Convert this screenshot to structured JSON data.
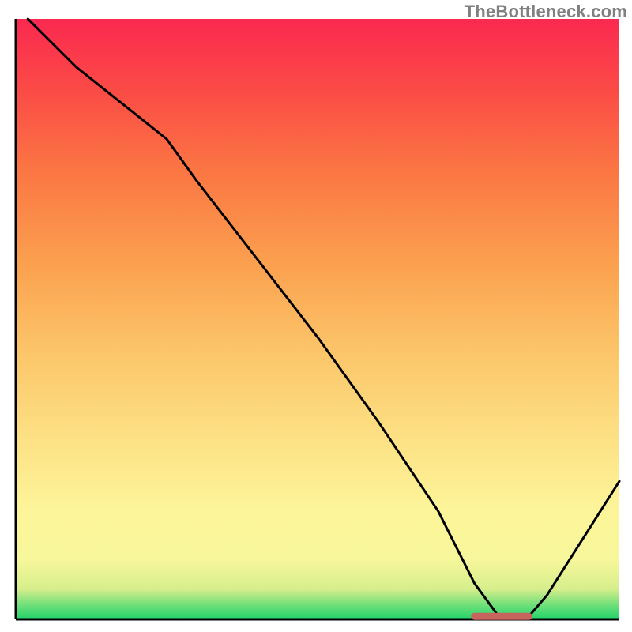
{
  "watermark": "TheBottleneck.com",
  "chart_data": {
    "type": "line",
    "title": "",
    "xlabel": "",
    "ylabel": "",
    "xlim": [
      0,
      100
    ],
    "ylim": [
      0,
      100
    ],
    "gradient": {
      "stops": [
        {
          "offset": 0.0,
          "color": "#22d36b"
        },
        {
          "offset": 0.025,
          "color": "#72e07a"
        },
        {
          "offset": 0.05,
          "color": "#d6ee8c"
        },
        {
          "offset": 0.1,
          "color": "#f7f79b"
        },
        {
          "offset": 0.18,
          "color": "#fdf59a"
        },
        {
          "offset": 0.3,
          "color": "#fde185"
        },
        {
          "offset": 0.45,
          "color": "#fcc468"
        },
        {
          "offset": 0.6,
          "color": "#fb9e4e"
        },
        {
          "offset": 0.75,
          "color": "#fb7543"
        },
        {
          "offset": 0.88,
          "color": "#fb4b46"
        },
        {
          "offset": 1.0,
          "color": "#fb2950"
        }
      ]
    },
    "series": [
      {
        "name": "bottleneck-curve",
        "x": [
          2,
          10,
          20,
          25,
          30,
          40,
          50,
          60,
          70,
          76,
          80,
          85,
          88,
          100
        ],
        "y": [
          100,
          92,
          84,
          80,
          73,
          60,
          47,
          33,
          18,
          6,
          0.5,
          0.5,
          4,
          23
        ]
      }
    ],
    "marker": {
      "name": "optimal-range",
      "x_start": 76,
      "x_end": 85,
      "y": 0.5,
      "color": "#c7645e"
    }
  }
}
